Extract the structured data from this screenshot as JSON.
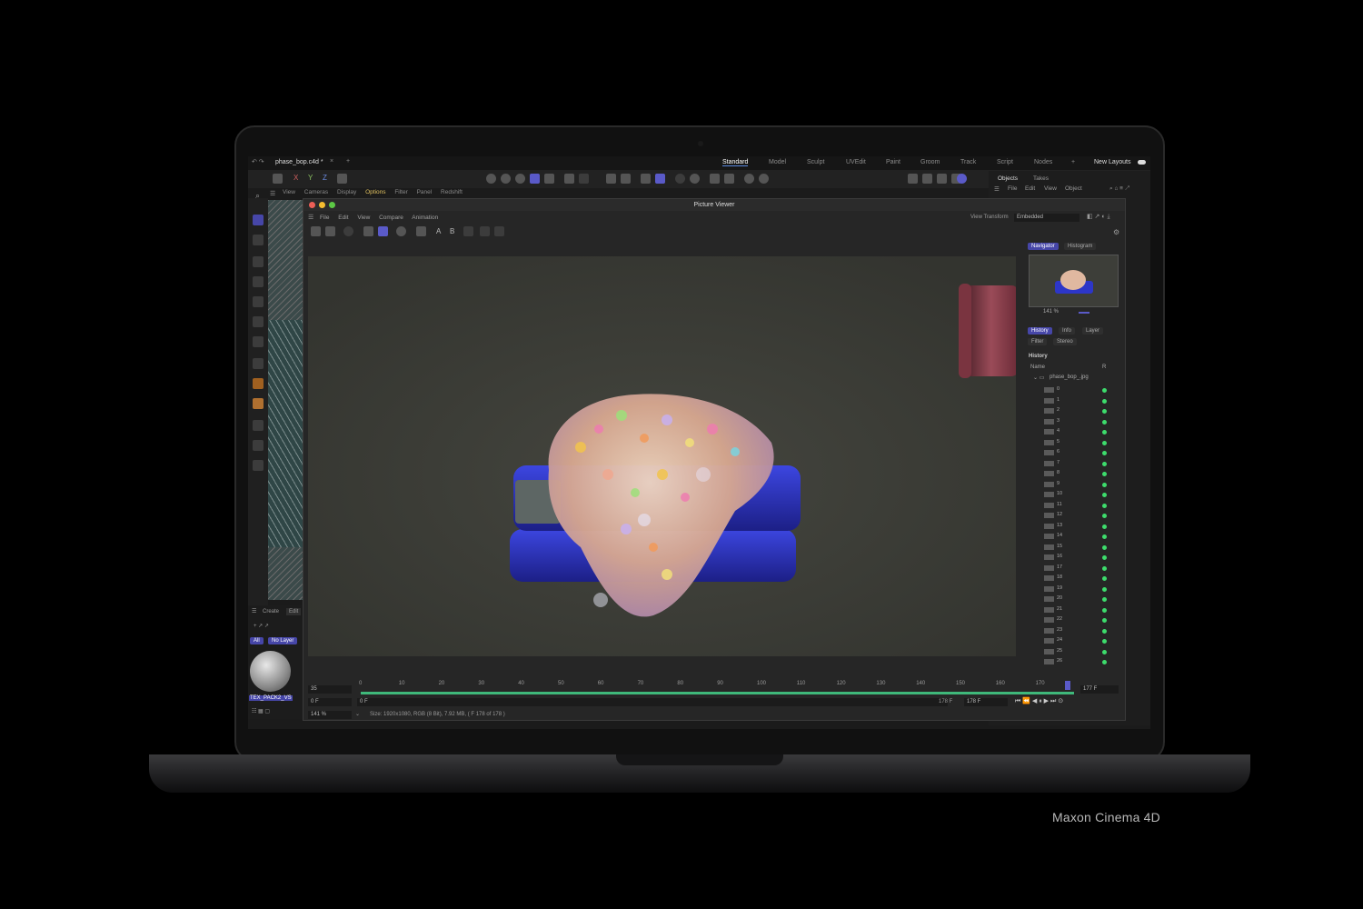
{
  "window": {
    "tab_title": "phase_bop.c4d *",
    "new_tab": "+"
  },
  "layouts": [
    "Standard",
    "Model",
    "Sculpt",
    "UVEdit",
    "Paint",
    "Groom",
    "Track",
    "Script",
    "Nodes",
    "+",
    "New Layouts"
  ],
  "axis_buttons": [
    "X",
    "Y",
    "Z"
  ],
  "viewport_menu": [
    "View",
    "Cameras",
    "Display",
    "Options",
    "Filter",
    "Panel",
    "Redshift"
  ],
  "objects_panel": {
    "tabs": [
      "Objects",
      "Takes"
    ],
    "menu": [
      "File",
      "Edit",
      "View",
      "Object"
    ]
  },
  "material_panel": {
    "tabs": [
      "Create",
      "Edit"
    ],
    "filters": [
      "All",
      "No Layer"
    ],
    "material_name": "TEX_PACK2_VS"
  },
  "picture_viewer": {
    "title": "Picture Viewer",
    "menu": [
      "File",
      "Edit",
      "View",
      "Compare",
      "Animation"
    ],
    "tool_letters": [
      "A",
      "B"
    ],
    "view_transform_label": "View Transform",
    "view_transform_value": "Embedded",
    "nav_tabs": [
      "Navigator",
      "Histogram"
    ],
    "zoom": "141 %",
    "info_tabs": [
      "History",
      "Info",
      "Layer"
    ],
    "info_tabs2": [
      "Filter",
      "Stereo"
    ],
    "history_heading": "History",
    "history_col_name": "Name",
    "history_col_r": "R",
    "history_folder": "phase_bop_.jpg",
    "history_items": [
      "0",
      "1",
      "2",
      "3",
      "4",
      "5",
      "6",
      "7",
      "8",
      "9",
      "10",
      "11",
      "12",
      "13",
      "14",
      "15",
      "16",
      "17",
      "18",
      "19",
      "20",
      "21",
      "22",
      "23",
      "24",
      "25",
      "26"
    ],
    "timeline_ticks": [
      "0",
      "10",
      "20",
      "30",
      "40",
      "50",
      "60",
      "70",
      "80",
      "90",
      "100",
      "110",
      "120",
      "130",
      "140",
      "150",
      "160",
      "170"
    ],
    "frame_left": "35",
    "frame_start": "0 F",
    "frame_start2": "0 F",
    "frame_end": "178 F",
    "frame_end2": "178 F",
    "frame_current": "177 F",
    "status_zoom": "141 %",
    "status_text": "Size: 1920x1080, RGB (8 Bit), 7.92 MB,  ( F 178 of 178 )"
  },
  "caption": "Maxon Cinema 4D"
}
